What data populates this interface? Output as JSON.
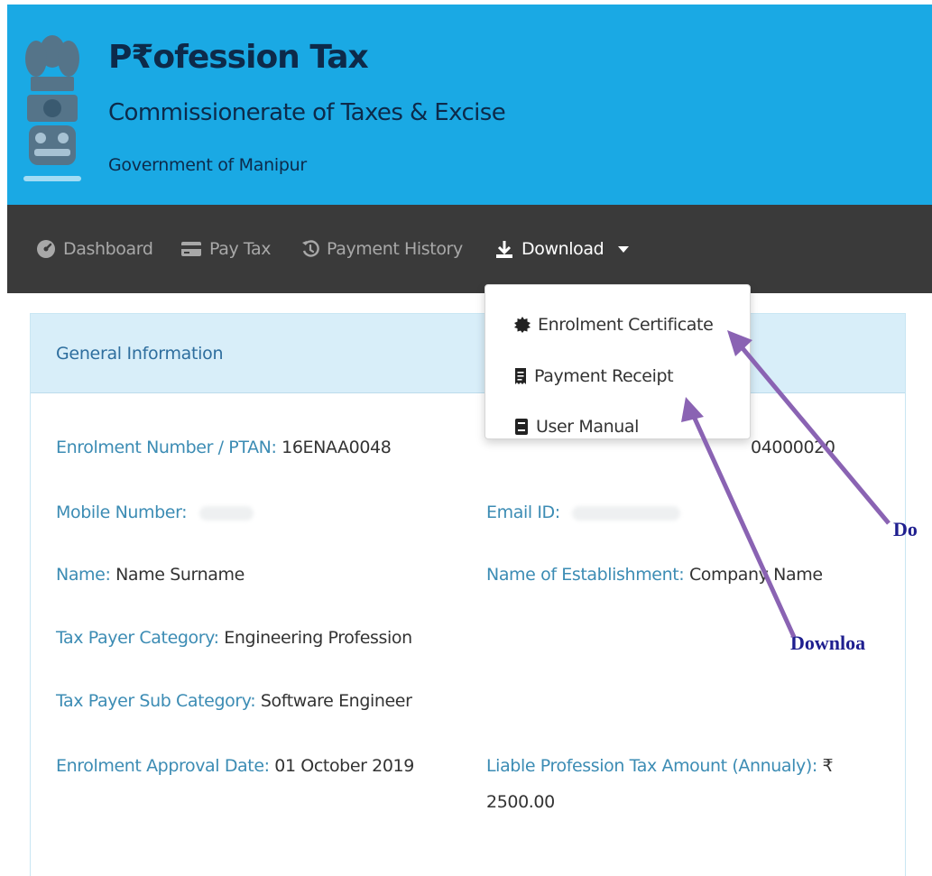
{
  "header": {
    "title": "P₹ofession Tax",
    "subtitle": "Commissionerate of Taxes & Excise",
    "government": "Government of Manipur",
    "bg_color": "#1aa9e4"
  },
  "nav": {
    "items": [
      {
        "label": "Dashboard",
        "icon": "dashboard-icon"
      },
      {
        "label": "Pay Tax",
        "icon": "credit-card-icon"
      },
      {
        "label": "Payment History",
        "icon": "history-icon"
      },
      {
        "label": "Download",
        "icon": "download-icon"
      }
    ],
    "bg_color": "#3a3a3a"
  },
  "dropdown": {
    "items": [
      {
        "label": "Enrolment Certificate",
        "icon": "certificate-icon"
      },
      {
        "label": "Payment Receipt",
        "icon": "receipt-icon"
      },
      {
        "label": "User Manual",
        "icon": "book-icon"
      }
    ]
  },
  "panel": {
    "heading": "General Information",
    "fields": {
      "enrolment_number": {
        "label": "Enrolment Number / PTAN:",
        "value": "16ENAA0048"
      },
      "partial_value": "04000020",
      "mobile": {
        "label": "Mobile Number:"
      },
      "email": {
        "label": "Email ID:"
      },
      "name": {
        "label": "Name:",
        "value": "Name Surname"
      },
      "establishment": {
        "label": "Name of Establishment:",
        "value": "Company Name"
      },
      "category": {
        "label": "Tax Payer Category:",
        "value": "Engineering Profession"
      },
      "sub_category": {
        "label": "Tax Payer Sub Category:",
        "value": "Software Engineer"
      },
      "approval_date": {
        "label": "Enrolment Approval Date:",
        "value": "01 October 2019"
      },
      "liable_amount": {
        "label": "Liable Profession Tax Amount (Annualy):",
        "currency": "₹",
        "value": "2500.00"
      }
    }
  },
  "annotations": {
    "first": "Do",
    "second": "Downloa",
    "arrow_color": "#8a63b3"
  }
}
